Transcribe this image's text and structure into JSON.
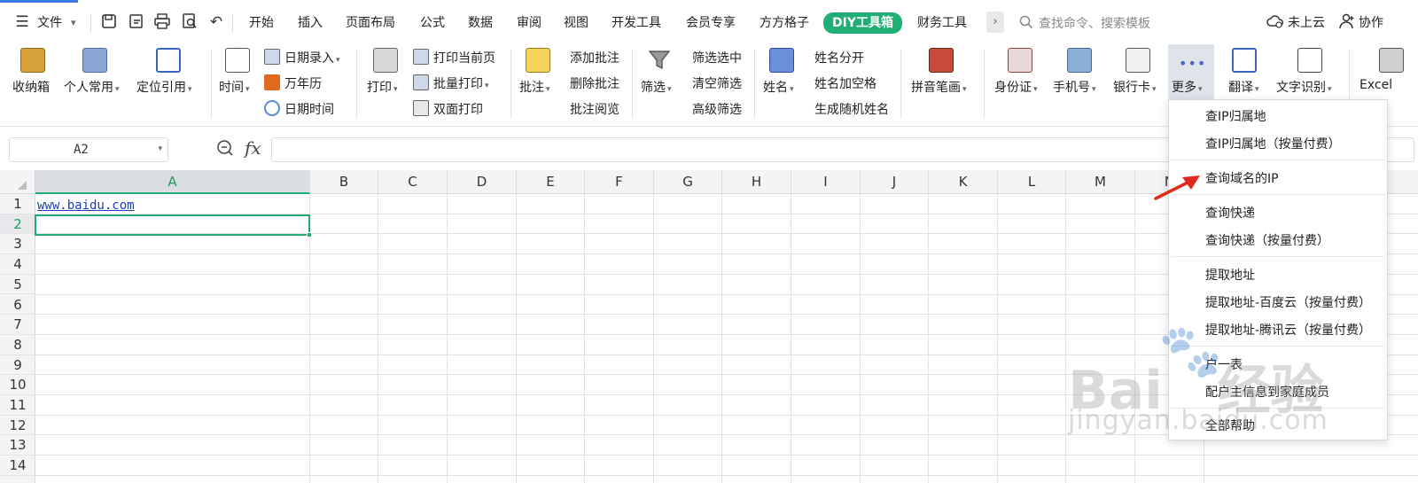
{
  "menubar": {
    "file_label": "文件",
    "tabs": [
      "开始",
      "插入",
      "页面布局",
      "公式",
      "数据",
      "审阅",
      "视图",
      "开发工具",
      "会员专享",
      "方方格子",
      "DIY工具箱",
      "财务工具"
    ],
    "active_tab": "DIY工具箱",
    "more_tabs": "›",
    "search_placeholder": "查找命令、搜索模板",
    "cloud_label": "未上云",
    "collab_label": "协作"
  },
  "ribbon": {
    "storage_box": "收纳箱",
    "personal_common": "个人常用",
    "locate_ref": "定位引用",
    "time": "时间",
    "date_entry": "日期录入",
    "perpetual_calendar": "万年历",
    "date_time": "日期时间",
    "print": "打印",
    "print_current_page": "打印当前页",
    "batch_print": "批量打印",
    "duplex_print": "双面打印",
    "annotate": "批注",
    "add_annotation": "添加批注",
    "delete_annotation": "删除批注",
    "view_annotation": "批注阅览",
    "filter": "筛选",
    "filter_selected": "筛选选中",
    "clear_filter": "清空筛选",
    "advanced_filter": "高级筛选",
    "name": "姓名",
    "split_name": "姓名分开",
    "name_add_space": "姓名加空格",
    "random_name": "生成随机姓名",
    "pinyin_strokes": "拼音笔画",
    "id_card": "身份证",
    "phone": "手机号",
    "bank_card": "银行卡",
    "more": "更多",
    "translate": "翻译",
    "ocr": "文字识别",
    "excel": "Excel"
  },
  "formula_bar": {
    "name_box": "A2",
    "fx": "fx",
    "formula": ""
  },
  "grid": {
    "columns": [
      "A",
      "B",
      "C",
      "D",
      "E",
      "F",
      "G",
      "H",
      "I",
      "J",
      "K",
      "L",
      "M",
      "N"
    ],
    "rows": [
      "1",
      "2",
      "3",
      "4",
      "5",
      "6",
      "7",
      "8",
      "9",
      "10",
      "11",
      "12",
      "13",
      "14"
    ],
    "a1_value": "www.baidu.com",
    "selected_cell": "A2"
  },
  "dropdown": {
    "items": [
      "查IP归属地",
      "查IP归属地（按量付费）",
      "查询域名的IP",
      "查询快递",
      "查询快递（按量付费）",
      "提取地址",
      "提取地址-百度云（按量付费）",
      "提取地址-腾讯云（按量付费）",
      "户一表",
      "配户主信息到家庭成员",
      "全部帮助"
    ]
  },
  "watermark": {
    "brand": "Bai",
    "brand_tail": "经验",
    "url": "jingyan.baidu.com"
  },
  "colors": {
    "accent_green": "#1fae73",
    "link_blue": "#1a3fb8",
    "arrow_red": "#e02a20"
  }
}
